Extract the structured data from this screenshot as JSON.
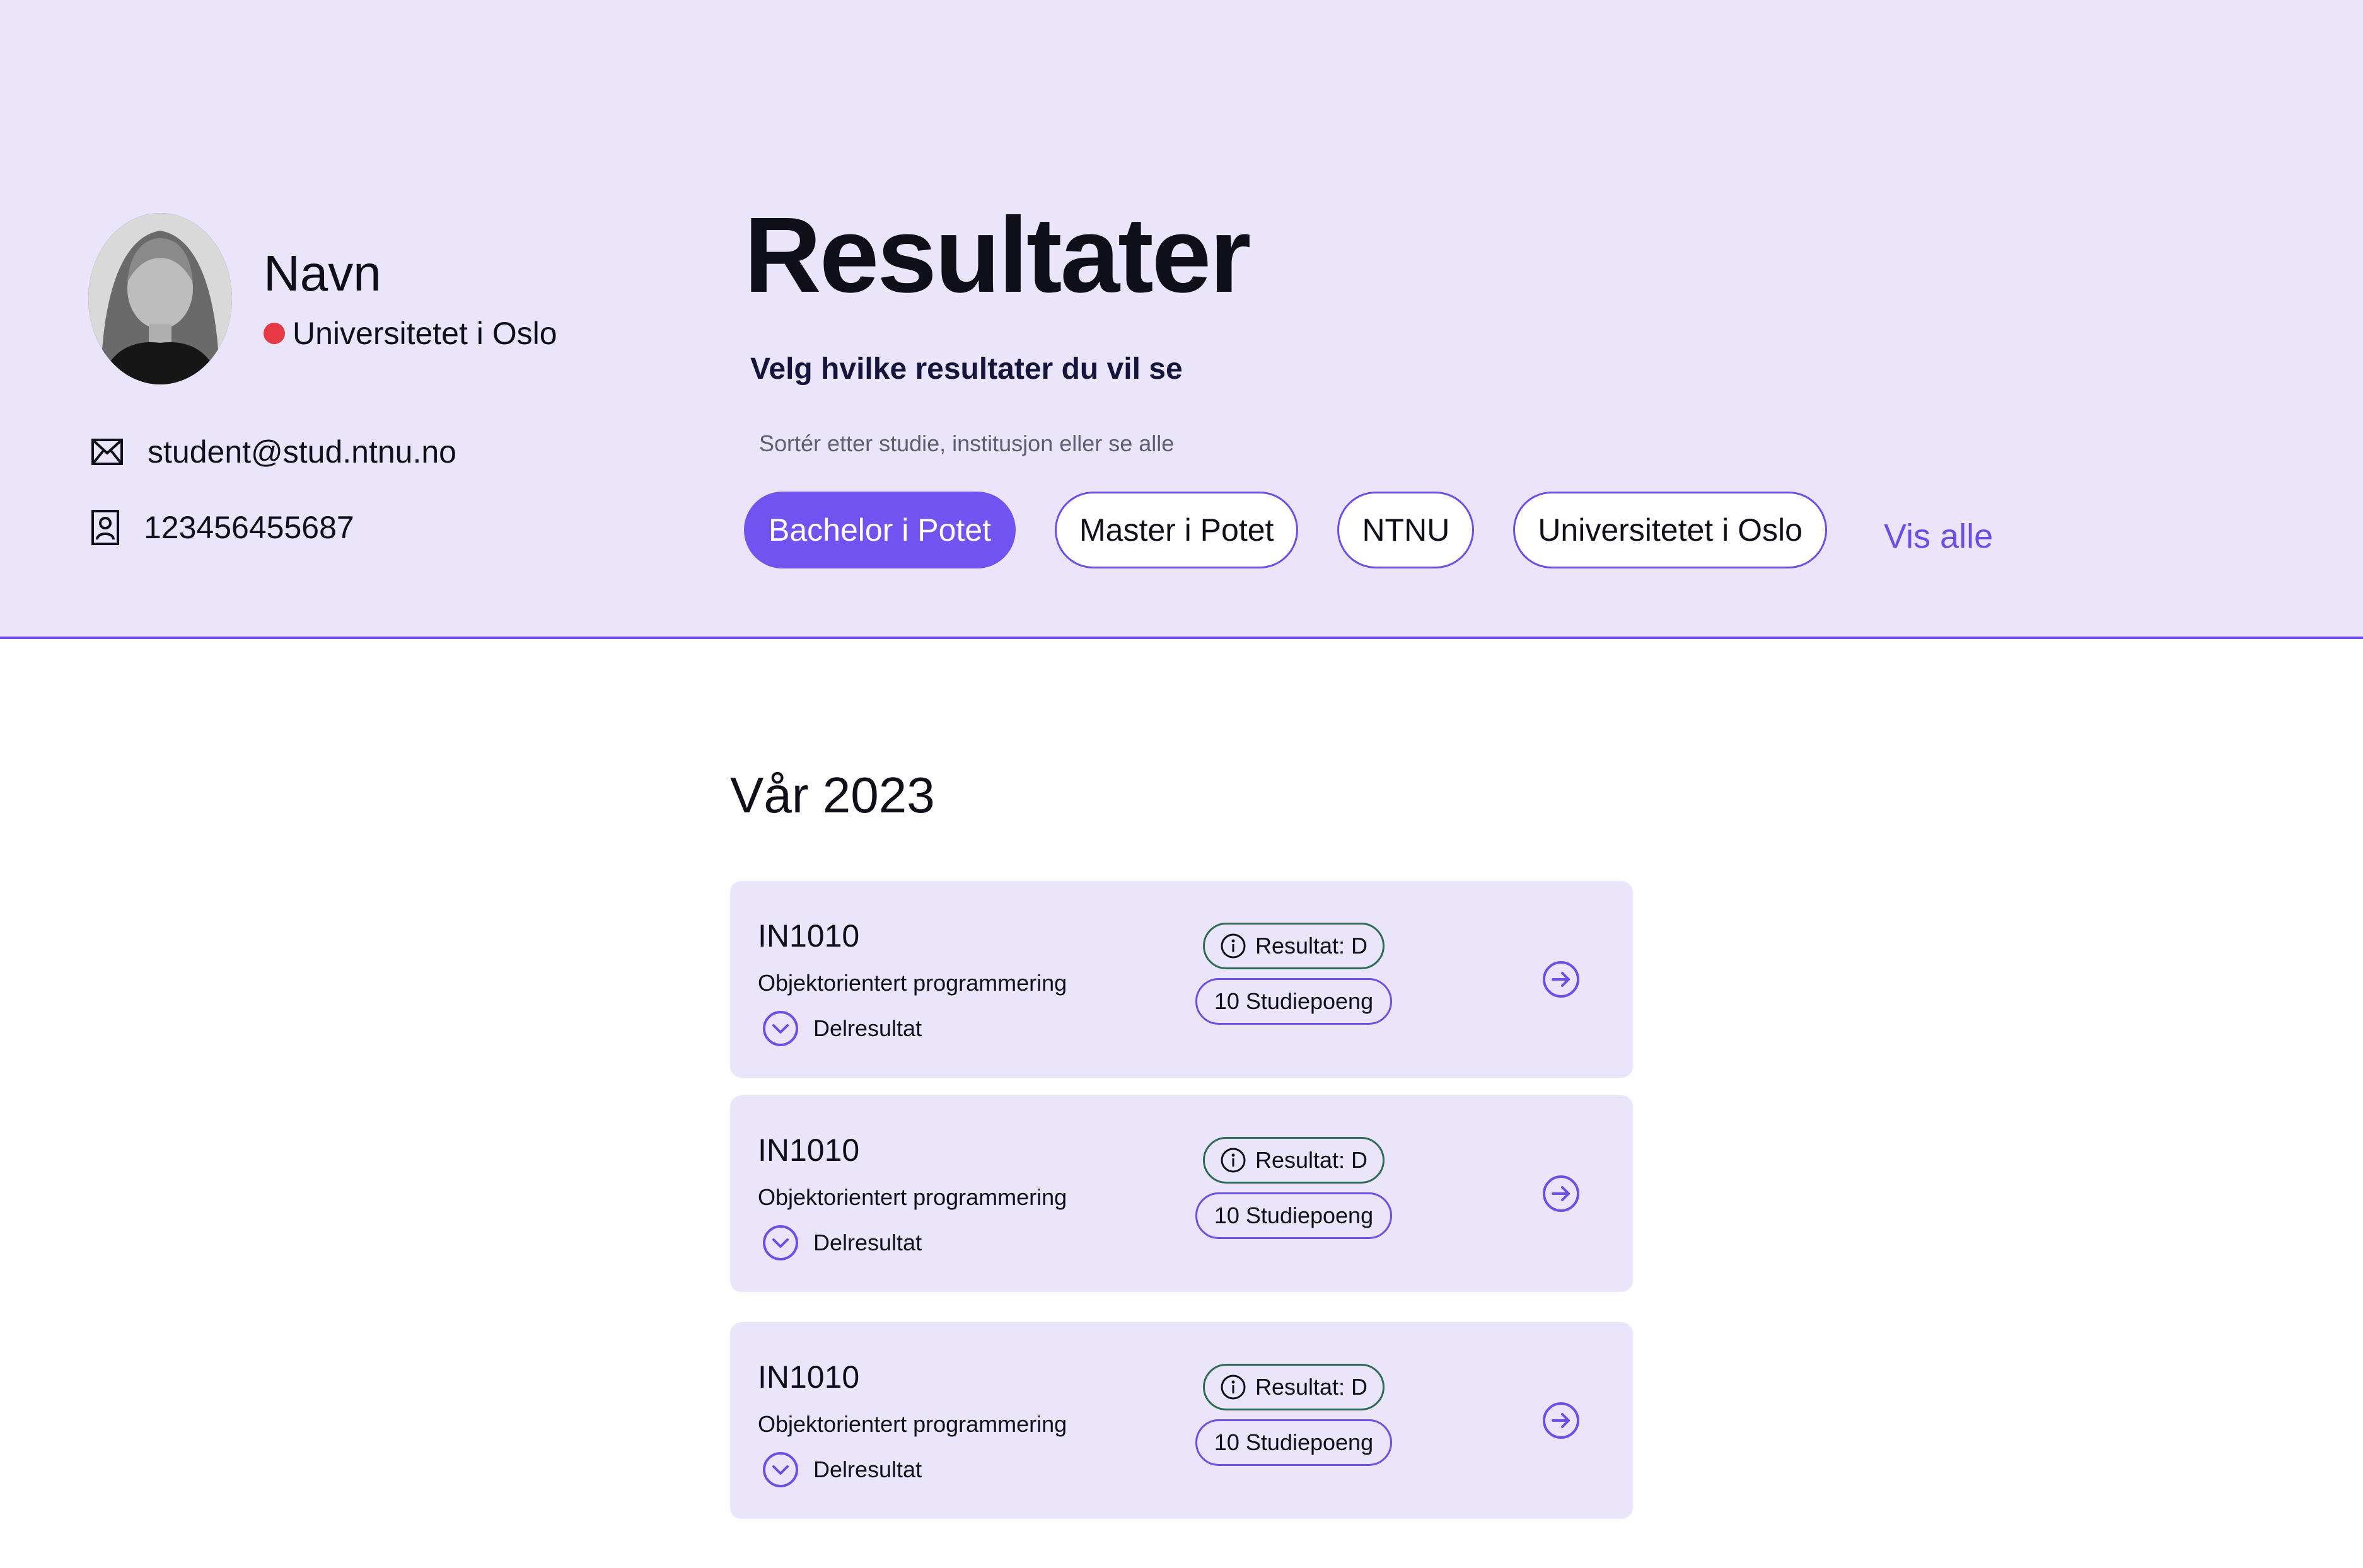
{
  "colors": {
    "header_bg": "#ebe5fb",
    "accent": "#6d4ee6",
    "active_chip": "#7154f0",
    "result_badge_border": "#2e6b57",
    "university_dot": "#e63946"
  },
  "profile": {
    "name": "Navn",
    "university": "Universitetet i Oslo",
    "email": "student@stud.ntnu.no",
    "student_id": "123456455687",
    "email_icon": "envelope-icon",
    "id_icon": "id-card-icon"
  },
  "header": {
    "title": "Resultater",
    "subtitle": "Velg hvilke resultater du vil se",
    "helper": "Sortér etter studie, institusjon eller se alle",
    "filters": [
      {
        "label": "Bachelor i Potet",
        "active": true
      },
      {
        "label": "Master i Potet",
        "active": false
      },
      {
        "label": "NTNU",
        "active": false
      },
      {
        "label": "Universitetet i Oslo",
        "active": false
      }
    ],
    "show_all": "Vis alle"
  },
  "semester": {
    "title": "Vår 2023",
    "courses": [
      {
        "code": "IN1010",
        "name": "Objektorientert programmering",
        "subresults": "Delresultat",
        "result": "Resultat: D",
        "credits": "10 Studiepoeng"
      },
      {
        "code": "IN1010",
        "name": "Objektorientert programmering",
        "subresults": "Delresultat",
        "result": "Resultat: D",
        "credits": "10 Studiepoeng"
      },
      {
        "code": "IN1010",
        "name": "Objektorientert programmering",
        "subresults": "Delresultat",
        "result": "Resultat: D",
        "credits": "10 Studiepoeng"
      }
    ]
  }
}
